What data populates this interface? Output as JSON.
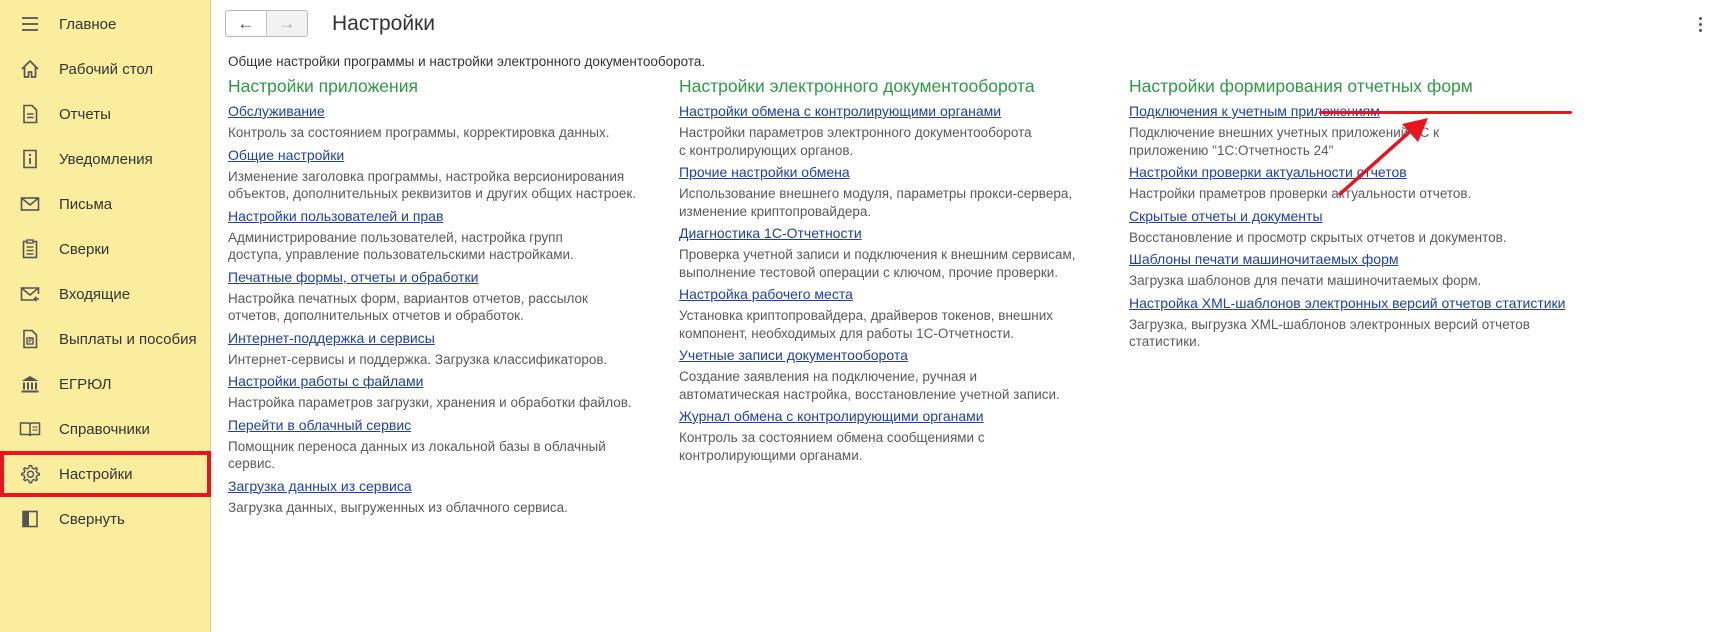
{
  "sidebar": {
    "items": [
      {
        "label": "Главное",
        "icon": "menu-icon"
      },
      {
        "label": "Рабочий стол",
        "icon": "home-icon"
      },
      {
        "label": "Отчеты",
        "icon": "document-icon"
      },
      {
        "label": "Уведомления",
        "icon": "info-icon"
      },
      {
        "label": "Письма",
        "icon": "mail-icon"
      },
      {
        "label": "Сверки",
        "icon": "checklist-icon"
      },
      {
        "label": "Входящие",
        "icon": "incoming-mail-icon"
      },
      {
        "label": "Выплаты и пособия",
        "icon": "payments-icon"
      },
      {
        "label": "ЕГРЮЛ",
        "icon": "bank-icon"
      },
      {
        "label": "Справочники",
        "icon": "book-icon"
      },
      {
        "label": "Настройки",
        "icon": "gear-icon",
        "active": true
      },
      {
        "label": "Свернуть",
        "icon": "collapse-icon"
      }
    ]
  },
  "header": {
    "title": "Настройки",
    "back_icon": "←",
    "forward_icon": "→"
  },
  "intro": "Общие настройки программы и настройки электронного документооборота.",
  "columns": [
    {
      "title": "Настройки приложения",
      "entries": [
        {
          "link": "Обслуживание",
          "desc": "Контроль за состоянием программы, корректировка данных."
        },
        {
          "link": "Общие настройки",
          "desc": "Изменение заголовка программы, настройка версионирования объектов, дополнительных реквизитов и других общих настроек."
        },
        {
          "link": "Настройки пользователей и прав",
          "desc": "Администрирование пользователей, настройка групп доступа, управление пользовательскими настройками."
        },
        {
          "link": "Печатные формы, отчеты и обработки",
          "desc": "Настройка печатных форм, вариантов отчетов, рассылок отчетов, дополнительных отчетов и обработок."
        },
        {
          "link": "Интернет-поддержка и сервисы",
          "desc": "Интернет-сервисы и поддержка. Загрузка классификаторов."
        },
        {
          "link": "Настройки работы с файлами",
          "desc": "Настройка параметров загрузки, хранения и обработки файлов."
        },
        {
          "link": "Перейти в облачный сервис",
          "desc": "Помощник переноса данных из локальной базы в облачный сервис."
        },
        {
          "link": "Загрузка данных из сервиса",
          "desc": "Загрузка данных, выгруженных из облачного сервиса."
        }
      ]
    },
    {
      "title": "Настройки электронного документооборота",
      "entries": [
        {
          "link": "Настройки обмена с контролирующими органами",
          "desc": "Настройки параметров электронного документооборота с контролирующих органов."
        },
        {
          "link": "Прочие настройки обмена",
          "desc": "Использование внешнего модуля, параметры прокси-сервера, изменение криптопровайдера."
        },
        {
          "link": "Диагностика 1С-Отчетности",
          "desc": "Проверка учетной записи и подключения к внешним сервисам, выполнение тестовой операции с ключом, прочие проверки."
        },
        {
          "link": "Настройка рабочего места",
          "desc": "Установка криптопровайдера, драйверов токенов, внешних компонент, необходимых для работы 1С-Отчетности."
        },
        {
          "link": "Учетные записи документооборота",
          "desc": "Создание заявления на подключение, ручная и автоматическая настройка, восстановление учетной записи."
        },
        {
          "link": "Журнал обмена с контролирующими органами",
          "desc": "Контроль за состоянием обмена сообщениями с контролирующими органами."
        }
      ]
    },
    {
      "title": "Настройки формирования отчетных форм",
      "entries": [
        {
          "link": "Подключения к учетным приложениям",
          "desc": "Подключение внешних учетных приложений 1С к приложению \"1С:Отчетность 24\""
        },
        {
          "link": "Настройки проверки актуальности отчетов",
          "desc": "Настройки праметров проверки актуальности отчетов."
        },
        {
          "link": "Скрытые отчеты и документы",
          "desc": "Восстановление и просмотр скрытых отчетов и документов."
        },
        {
          "link": "Шаблоны печати машиночитаемых форм",
          "desc": "Загрузка шаблонов для печати машиночитаемых форм."
        },
        {
          "link": "Настройка XML-шаблонов электронных версий отчетов статистики",
          "desc": "Загрузка, выгрузка XML-шаблонов электронных версий отчетов статистики."
        }
      ]
    }
  ],
  "colors": {
    "sidebar_bg": "#fbed9e",
    "section_title": "#2e9a46",
    "link": "#1d3fb0",
    "annotation": "#e8141e"
  }
}
